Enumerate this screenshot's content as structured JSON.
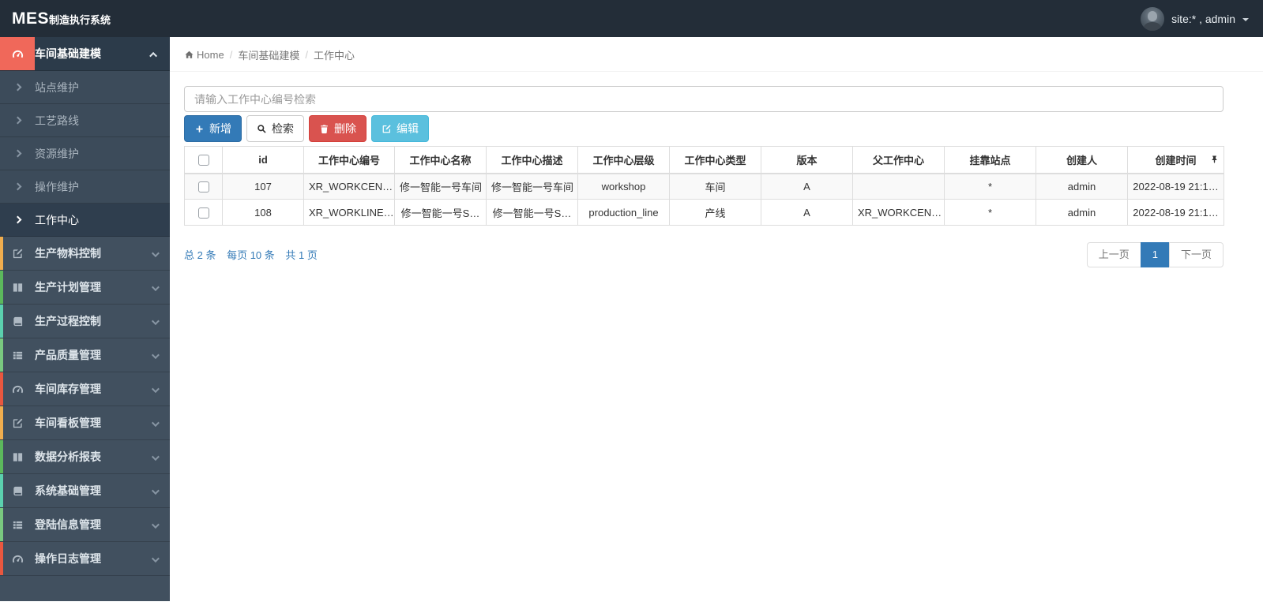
{
  "navbar": {
    "logo_mes": "MES",
    "logo_suffix": "制造执行系统",
    "user_label": "site:* , admin"
  },
  "breadcrumb": {
    "home": "Home",
    "separator": "/",
    "section": "车间基础建模",
    "current": "工作中心"
  },
  "sidebar": {
    "open_group": {
      "label": "车间基础建模"
    },
    "submenu": [
      "站点维护",
      "工艺路线",
      "资源维护",
      "操作维护",
      "工作中心"
    ],
    "groups": [
      {
        "label": "生产物料控制"
      },
      {
        "label": "生产计划管理"
      },
      {
        "label": "生产过程控制"
      },
      {
        "label": "产品质量管理"
      },
      {
        "label": "车间库存管理"
      },
      {
        "label": "车间看板管理"
      },
      {
        "label": "数据分析报表"
      },
      {
        "label": "系统基础管理"
      },
      {
        "label": "登陆信息管理"
      },
      {
        "label": "操作日志管理"
      }
    ]
  },
  "toolbar": {
    "search_placeholder": "请输入工作中心编号检索",
    "add_label": "新增",
    "search_label": "检索",
    "delete_label": "删除",
    "edit_label": "编辑"
  },
  "table": {
    "headers": [
      "id",
      "工作中心编号",
      "工作中心名称",
      "工作中心描述",
      "工作中心层级",
      "工作中心类型",
      "版本",
      "父工作中心",
      "挂靠站点",
      "创建人",
      "创建时间"
    ],
    "rows": [
      [
        "107",
        "XR_WORKCEN…",
        "修一智能一号车间",
        "修一智能一号车间",
        "workshop",
        "车间",
        "A",
        "",
        "*",
        "admin",
        "2022-08-19 21:1…"
      ],
      [
        "108",
        "XR_WORKLINE…",
        "修一智能一号S…",
        "修一智能一号S…",
        "production_line",
        "产线",
        "A",
        "XR_WORKCEN…",
        "*",
        "admin",
        "2022-08-19 21:1…"
      ]
    ]
  },
  "pagination": {
    "summary_total": "总 2 条",
    "summary_per_page": "每页 10 条",
    "summary_pages": "共 1 页",
    "prev": "上一页",
    "page": "1",
    "next": "下一页"
  },
  "colors": {
    "navbar_bg": "#232d38",
    "sidebar_bg": "#41505f",
    "active_group_red": "#f0685a",
    "primary": "#337ab7",
    "danger": "#d9534f",
    "info": "#5bc0de",
    "summary_link": "#337ab7",
    "strip_cycle": [
      "#f0ad4e",
      "#5cb85c",
      "#5bd0ae",
      "#79c87f",
      "#e9573f"
    ]
  }
}
